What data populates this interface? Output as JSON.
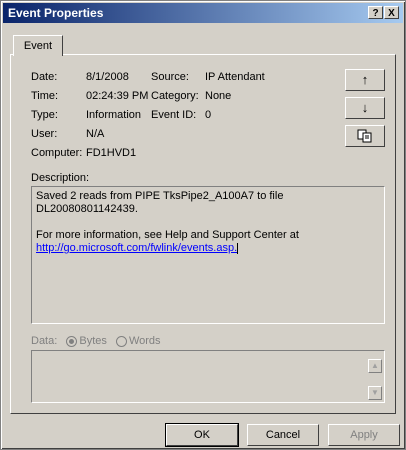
{
  "window": {
    "title": "Event Properties",
    "help_btn": "?",
    "close_btn": "X"
  },
  "tab": {
    "label": "Event"
  },
  "fields": {
    "date_label": "Date:",
    "date": "8/1/2008",
    "time_label": "Time:",
    "time": "02:24:39 PM",
    "type_label": "Type:",
    "type": "Information",
    "user_label": "User:",
    "user": "N/A",
    "computer_label": "Computer:",
    "computer": "FD1HVD1",
    "source_label": "Source:",
    "source": "IP Attendant",
    "category_label": "Category:",
    "category": "None",
    "eventid_label": "Event ID:",
    "eventid": "0"
  },
  "description": {
    "label": "Description:",
    "line1": "Saved 2 reads from PIPE TksPipe2_A100A7 to file DL20080801142439.",
    "line2": "For more information, see Help and Support Center at",
    "link": "http://go.microsoft.com/fwlink/events.asp."
  },
  "data": {
    "label": "Data:",
    "bytes": "Bytes",
    "words": "Words",
    "selected": "Bytes"
  },
  "side_buttons": {
    "up": "↑",
    "down": "↓",
    "copy": "copy"
  },
  "footer": {
    "ok": "OK",
    "cancel": "Cancel",
    "apply": "Apply"
  }
}
